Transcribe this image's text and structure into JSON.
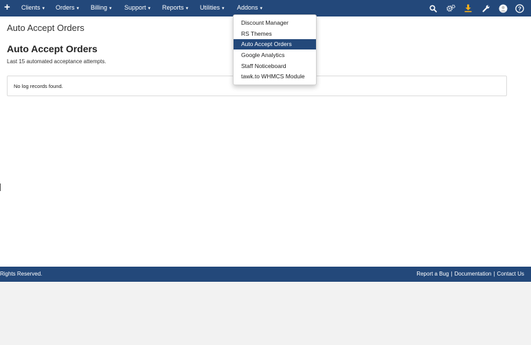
{
  "topbar": {
    "bg": "#23487a",
    "plus_icon": "plus-icon",
    "menus": [
      {
        "label": "Clients",
        "caret": "▾"
      },
      {
        "label": "Orders",
        "caret": "▾"
      },
      {
        "label": "Billing",
        "caret": "▾"
      },
      {
        "label": "Support",
        "caret": "▾"
      },
      {
        "label": "Reports",
        "caret": "▾"
      },
      {
        "label": "Utilities",
        "caret": "▾"
      },
      {
        "label": "Addons",
        "caret": "▾"
      }
    ],
    "right_icons": [
      "search-icon",
      "cogs-icon",
      "download-icon",
      "wrench-icon",
      "avatar-icon",
      "help-icon"
    ],
    "download_color": "#f0ad1c"
  },
  "addons_menu": {
    "items": [
      {
        "label": "Discount Manager",
        "active": false
      },
      {
        "label": "RS Themes",
        "active": false
      },
      {
        "label": "Auto Accept Orders",
        "active": true
      },
      {
        "label": "Google Analytics",
        "active": false
      },
      {
        "label": "Staff Noticeboard",
        "active": false
      },
      {
        "label": "tawk.to WHMCS Module",
        "active": false
      }
    ],
    "active_color": "#23487a"
  },
  "page": {
    "breadcrumb_title": "Auto Accept Orders",
    "title": "Auto Accept Orders",
    "subtitle": "Last 15 automated acceptance attempts.",
    "empty_message": "No log records found."
  },
  "footer": {
    "copyright": "Rights Reserved.",
    "links": [
      "Report a Bug",
      "Documentation",
      "Contact Us"
    ],
    "separator": "|"
  }
}
